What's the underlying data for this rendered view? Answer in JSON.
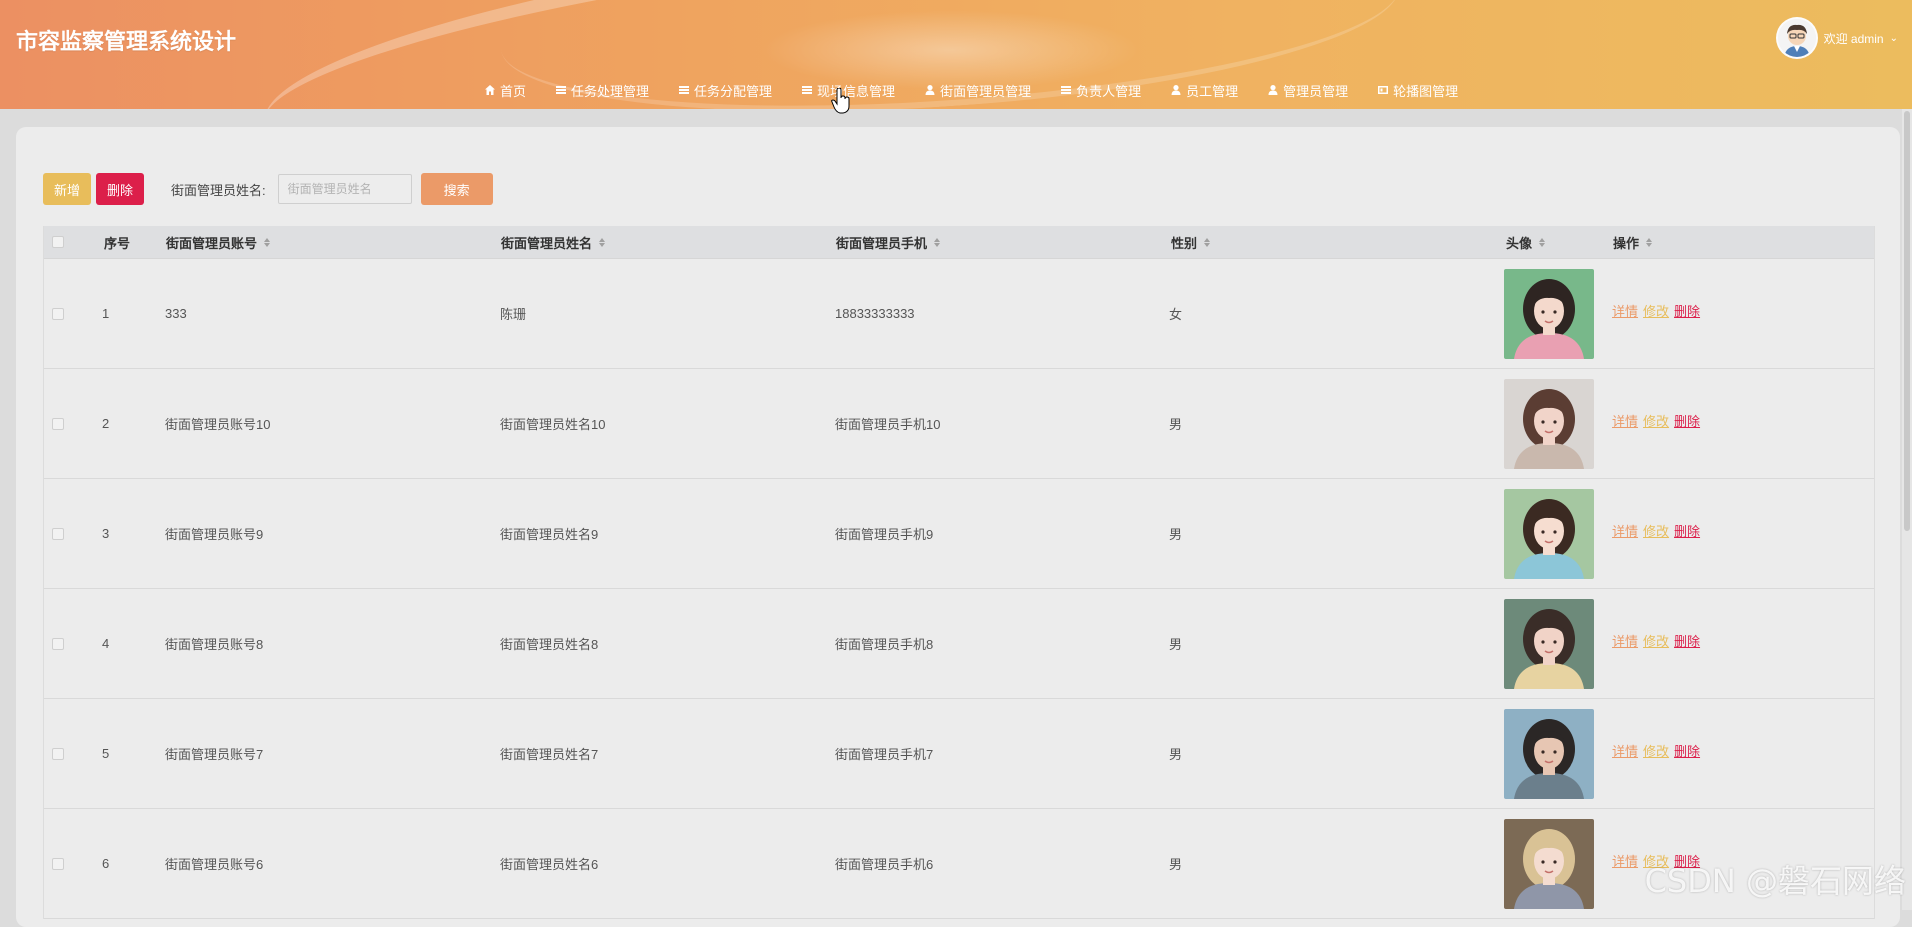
{
  "app": {
    "title": "市容监察管理系统设计",
    "user_greeting": "欢迎 admin"
  },
  "nav": {
    "items": [
      {
        "label": "首页",
        "icon": "home-icon"
      },
      {
        "label": "任务处理管理",
        "icon": "list-icon"
      },
      {
        "label": "任务分配管理",
        "icon": "list-icon"
      },
      {
        "label": "现场信息管理",
        "icon": "list-icon"
      },
      {
        "label": "街面管理员管理",
        "icon": "user-icon"
      },
      {
        "label": "负责人管理",
        "icon": "list-icon"
      },
      {
        "label": "员工管理",
        "icon": "user-icon"
      },
      {
        "label": "管理员管理",
        "icon": "user-icon"
      },
      {
        "label": "轮播图管理",
        "icon": "image-icon"
      }
    ]
  },
  "toolbar": {
    "add_label": "新增",
    "delete_label": "删除",
    "search_label": "街面管理员姓名:",
    "search_placeholder": "街面管理员姓名",
    "search_button": "搜索"
  },
  "table": {
    "headers": {
      "index": "序号",
      "account": "街面管理员账号",
      "name": "街面管理员姓名",
      "phone": "街面管理员手机",
      "gender": "性别",
      "avatar": "头像",
      "actions": "操作"
    },
    "action_labels": {
      "detail": "详情",
      "edit": "修改",
      "delete": "删除"
    },
    "rows": [
      {
        "index": "1",
        "account": "333",
        "name": "陈珊",
        "phone": "18833333333",
        "gender": "女"
      },
      {
        "index": "2",
        "account": "街面管理员账号10",
        "name": "街面管理员姓名10",
        "phone": "街面管理员手机10",
        "gender": "男"
      },
      {
        "index": "3",
        "account": "街面管理员账号9",
        "name": "街面管理员姓名9",
        "phone": "街面管理员手机9",
        "gender": "男"
      },
      {
        "index": "4",
        "account": "街面管理员账号8",
        "name": "街面管理员姓名8",
        "phone": "街面管理员手机8",
        "gender": "男"
      },
      {
        "index": "5",
        "account": "街面管理员账号7",
        "name": "街面管理员姓名7",
        "phone": "街面管理员手机7",
        "gender": "男"
      },
      {
        "index": "6",
        "account": "街面管理员账号6",
        "name": "街面管理员姓名6",
        "phone": "街面管理员手机6",
        "gender": "男"
      }
    ]
  },
  "watermark": "CSDN @磐石网络",
  "colors": {
    "header_start": "#ec9062",
    "header_end": "#ecbc5e",
    "add_button": "#e8bd5b",
    "delete_button": "#dc1f4a",
    "search_button": "#eb9a68"
  }
}
